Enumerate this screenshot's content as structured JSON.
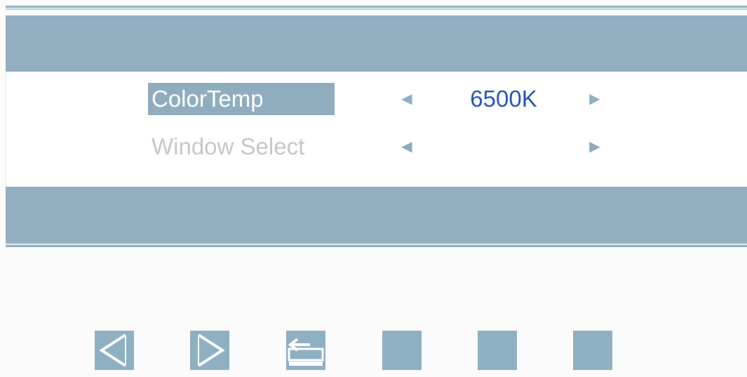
{
  "osd": {
    "items": [
      {
        "label": "ColorTemp",
        "value": "6500K",
        "selected": true
      },
      {
        "label": "Window Select",
        "value": "",
        "selected": false
      }
    ],
    "arrow_left_glyph": "◀",
    "arrow_right_glyph": "▶"
  },
  "buttons": [
    {
      "name": "left-arrow-icon"
    },
    {
      "name": "right-arrow-icon"
    },
    {
      "name": "return-icon"
    },
    {
      "name": "blank"
    },
    {
      "name": "blank"
    },
    {
      "name": "blank"
    }
  ],
  "colors": {
    "panel_bar": "#92afc2",
    "selection": "#90adc0",
    "value_text": "#2a57b5",
    "dim_text": "#c7c7c7"
  }
}
